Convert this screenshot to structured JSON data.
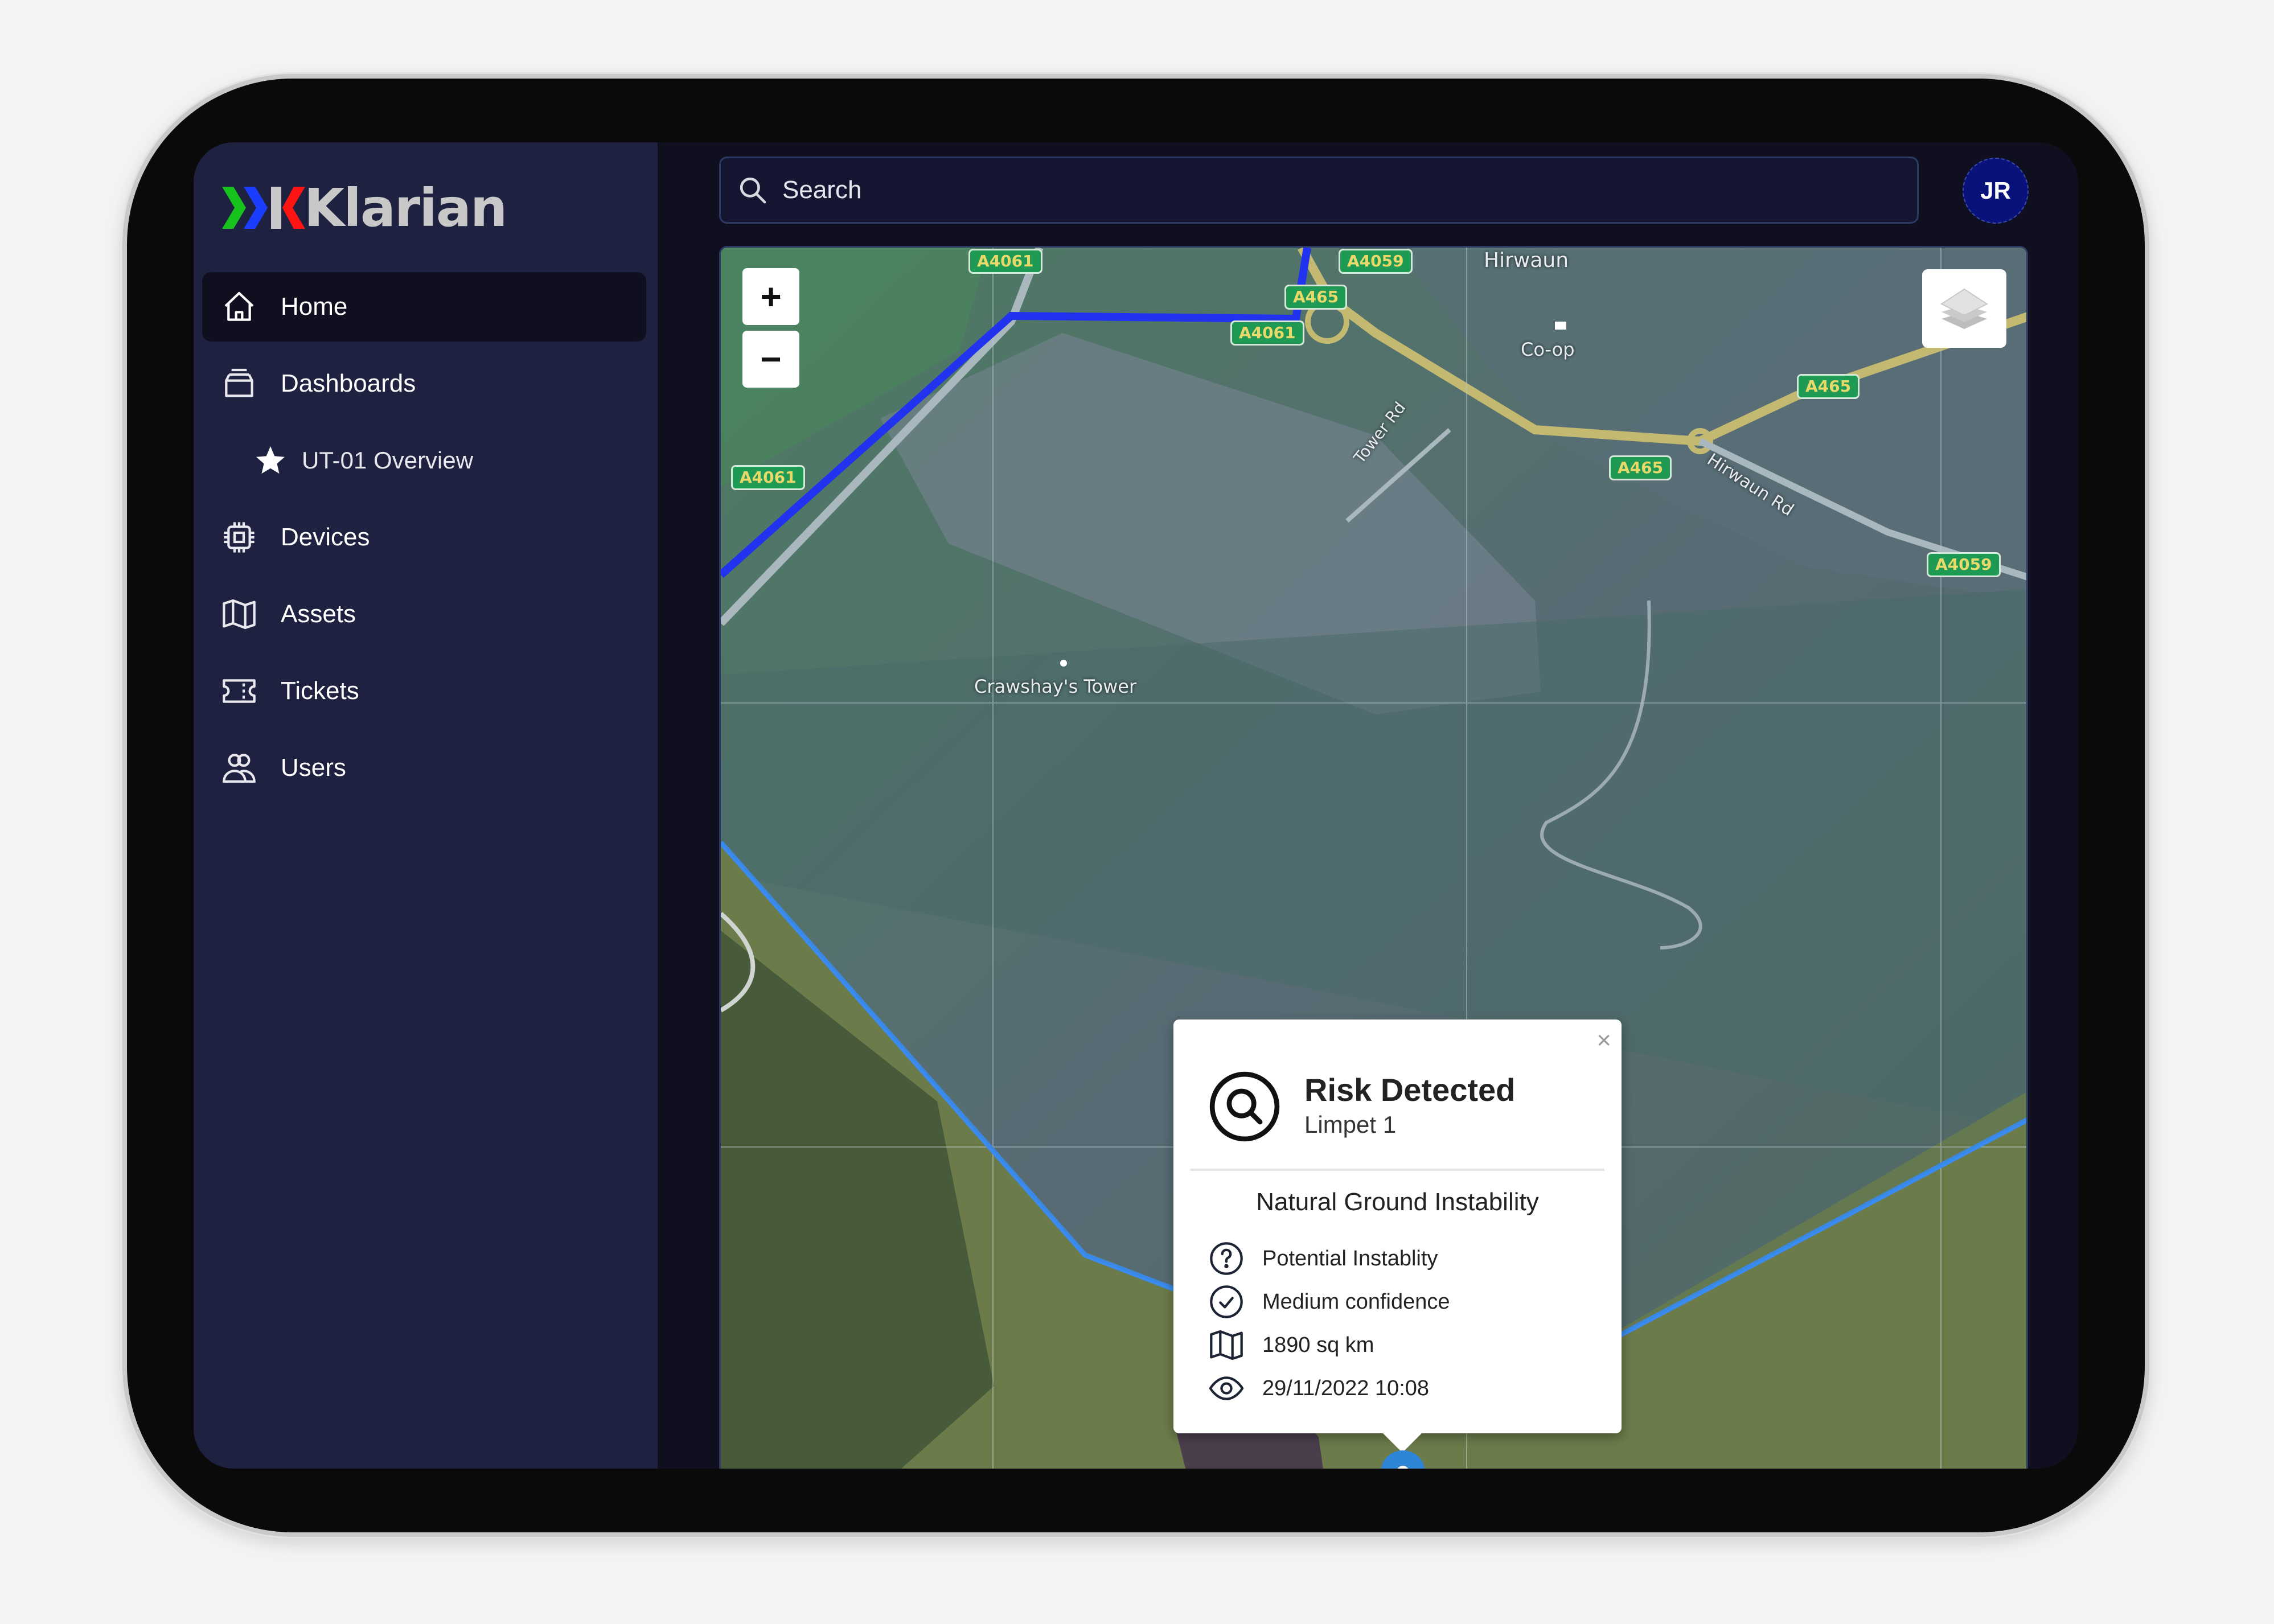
{
  "app": {
    "brand": "Klarian",
    "brand_colors": {
      "chevron_1": "#17c21d",
      "chevron_2": "#1a3dff",
      "k_chevron": "#ff1414",
      "text": "#c8c8c8"
    }
  },
  "sidebar": {
    "items": [
      {
        "label": "Home",
        "icon": "home-icon",
        "active": true
      },
      {
        "label": "Dashboards",
        "icon": "inbox-stack-icon",
        "active": false
      },
      {
        "label": "UT-01 Overview",
        "icon": "star-icon",
        "active": false,
        "sub": true
      },
      {
        "label": "Devices",
        "icon": "cpu-chip-icon",
        "active": false
      },
      {
        "label": "Assets",
        "icon": "map-icon",
        "active": false
      },
      {
        "label": "Tickets",
        "icon": "ticket-icon",
        "active": false
      },
      {
        "label": "Users",
        "icon": "users-icon",
        "active": false
      }
    ]
  },
  "header": {
    "search": {
      "placeholder": "Search",
      "value": ""
    },
    "avatar": {
      "initials": "JR",
      "color": "#08127a"
    }
  },
  "map": {
    "zoom_in_label": "+",
    "zoom_out_label": "−",
    "layers_icon": "layers-icon",
    "road_labels": [
      "A4061",
      "A4059",
      "A465",
      "A4061",
      "A4061",
      "A465",
      "A465",
      "A4059",
      "A465"
    ],
    "place_labels": {
      "town": "Hirwaun",
      "shop": "Co-op",
      "road_1": "Tower Rd",
      "road_2": "Hirwaun Rd",
      "landmark": "Crawshay's Tower"
    },
    "colors": {
      "route_line": "#1f2cff",
      "area_boundary": "#3a8cf2",
      "pin": "#2f86d6"
    }
  },
  "popup": {
    "title": "Risk Detected",
    "subtitle": "Limpet 1",
    "category": "Natural Ground Instability",
    "close_label": "×",
    "details": [
      {
        "icon": "question-circle-icon",
        "text": "Potential Instablity"
      },
      {
        "icon": "check-circle-icon",
        "text": "Medium confidence"
      },
      {
        "icon": "map-icon",
        "text": "1890 sq km"
      },
      {
        "icon": "eye-icon",
        "text": "29/11/2022 10:08"
      }
    ]
  }
}
